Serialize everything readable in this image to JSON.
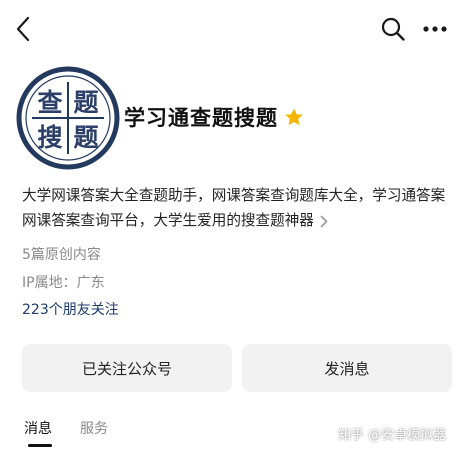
{
  "top_bar": {
    "back_icon": "chevron-left-icon",
    "search_icon": "search-icon",
    "more_icon": "more-horizontal-icon"
  },
  "profile": {
    "avatar_chars": [
      "查",
      "题",
      "搜",
      "题"
    ],
    "account_name": "学习通查题搜题",
    "badge_icon": "star-icon",
    "badge_color": "#F5B400",
    "description": "大学网课答案大全查题助手，网课答案查询题库大全，学习通答案网课答案查询平台，大学生爱用的搜查题神器",
    "posts": "5篇原创内容",
    "ip_location": "IP属地：广东",
    "friends": "223个朋友关注"
  },
  "actions": {
    "followed_label": "已关注公众号",
    "message_label": "发消息"
  },
  "tabs": [
    {
      "label": "消息"
    },
    {
      "label": "服务"
    }
  ],
  "watermark": "知乎 @安卓模拟器",
  "colors": {
    "avatar_ring": "#23395d",
    "avatar_chars": "#2b3f68",
    "friends_text": "#1f3a6b",
    "button_bg": "#f2f2f2"
  }
}
